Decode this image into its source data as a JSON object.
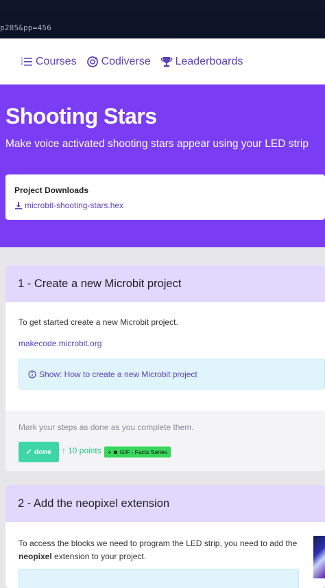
{
  "browser": {
    "url_fragment": "p285&pp=456"
  },
  "nav": {
    "items": [
      {
        "label": "Courses",
        "icon": "list-numbered-icon"
      },
      {
        "label": "Codiverse",
        "icon": "codiverse-icon"
      },
      {
        "label": "Leaderboards",
        "icon": "trophy-icon"
      }
    ]
  },
  "hero": {
    "title": "Shooting Stars",
    "subtitle": "Make voice activated shooting stars appear using your LED strip",
    "downloads": {
      "title": "Project Downloads",
      "file": "microbit-shooting-stars.hex"
    }
  },
  "steps": [
    {
      "heading": "1 - Create a new Microbit project",
      "text": "To get started create a new Microbit project.",
      "link": "makecode.microbit.org",
      "show": "Show: How to create a new Microbit project",
      "done_note": "Mark your steps as done as you complete them.",
      "done_label": "done",
      "points": "10 points",
      "badge": "GIF - Facts Series"
    },
    {
      "heading": "2 - Add the neopixel extension",
      "text_before": "To access the blocks we need to program the LED strip, you need to add the",
      "text_bold": "neopixel",
      "text_after": " extension to your project."
    }
  ],
  "colors": {
    "brand_purple": "#7a3df3",
    "link_purple": "#5b43b8",
    "card_header": "#e2d8fd",
    "done_green": "#3dd6a4",
    "badge_green": "#38d65a"
  }
}
